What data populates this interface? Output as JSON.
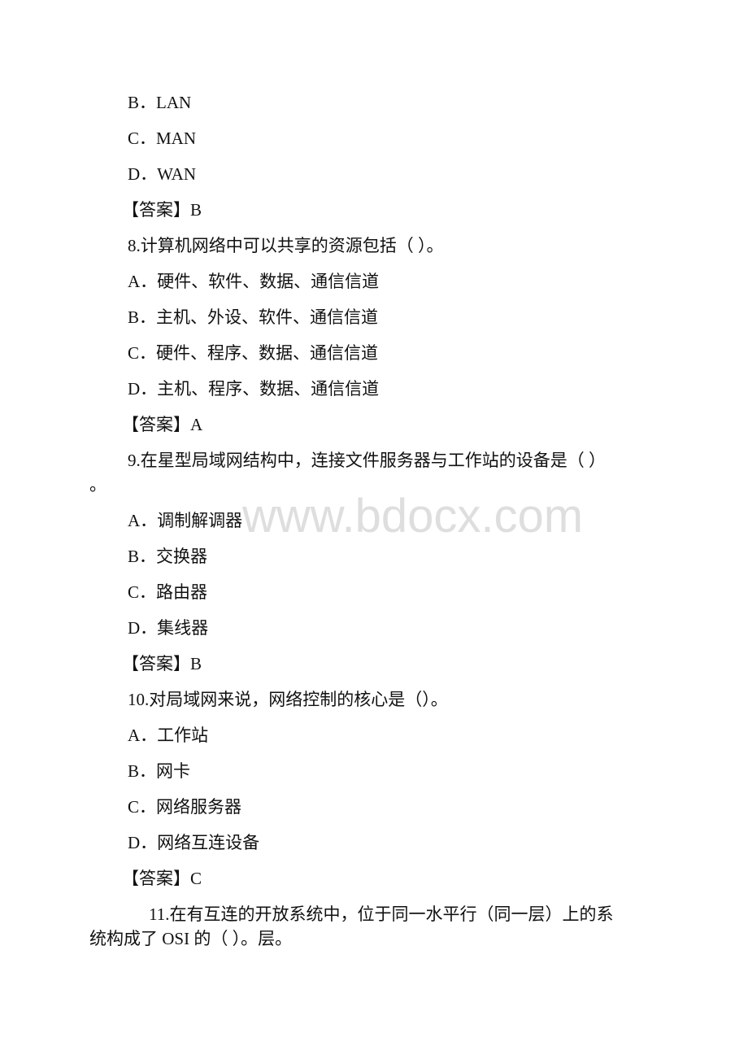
{
  "watermark": "www.bdocx.com",
  "q7": {
    "options": [
      "B．LAN",
      "C．MAN",
      "D．WAN"
    ],
    "answer": "【答案】B"
  },
  "q8": {
    "question": "8.计算机网络中可以共享的资源包括（ ）。",
    "options": [
      "A．硬件、软件、数据、通信信道",
      "B．主机、外设、软件、通信信道",
      "C．硬件、程序、数据、通信信道",
      "D．主机、程序、数据、通信信道"
    ],
    "answer": "【答案】A"
  },
  "q9": {
    "question": "9.在星型局域网结构中，连接文件服务器与工作站的设备是（ ）",
    "question_wrap": "。",
    "options": [
      "A．调制解调器",
      "B．交换器",
      "C．路由器",
      "D．集线器"
    ],
    "answer": "【答案】B"
  },
  "q10": {
    "question": "10.对局域网来说，网络控制的核心是（）。",
    "options": [
      "A．工作站",
      "B．网卡",
      "C．网络服务器",
      "D．网络互连设备"
    ],
    "answer": "【答案】C"
  },
  "q11": {
    "question_line1": "11.在有互连的开放系统中，位于同一水平行（同一层）上的系",
    "question_line2": "统构成了 OSI 的（ ）。层。"
  }
}
